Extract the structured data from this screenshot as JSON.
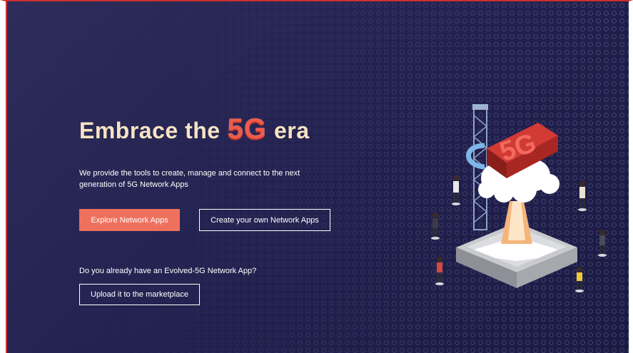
{
  "hero": {
    "headline_prefix": "Embrace the",
    "headline_highlight": "5G",
    "headline_suffix": "era",
    "subtitle": "We provide the tools to create, manage and connect to the next generation of 5G Network Apps",
    "explore_button_label": "Explore Network Apps",
    "create_button_label": "Create your own Network Apps",
    "upload_question": "Do you already have an Evolved-5G Network App?",
    "upload_button_label": "Upload it to the marketplace"
  },
  "illustration": {
    "sign_text": "5G"
  },
  "colors": {
    "background": "#242250",
    "accent": "#f0705e",
    "headline": "#f6e3c4",
    "highlight": "#ef5b4c"
  },
  "icons": [
    "5g-tower-illustration",
    "person-figure"
  ]
}
